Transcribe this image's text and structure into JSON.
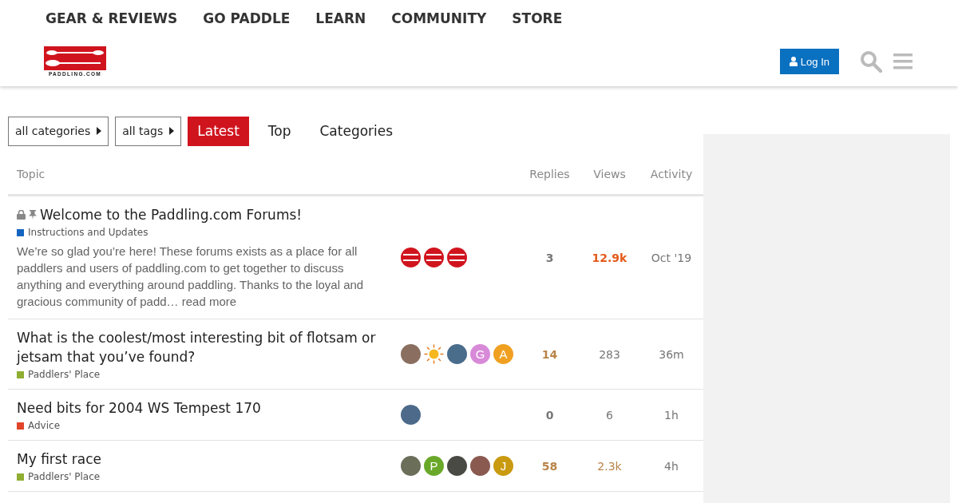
{
  "top_nav": [
    "GEAR & REVIEWS",
    "GO PADDLE",
    "LEARN",
    "COMMUNITY",
    "STORE"
  ],
  "logo": {
    "caption": "PADDLING.COM"
  },
  "header_actions": {
    "login": "Log In"
  },
  "filters": [
    {
      "label": "all categories"
    },
    {
      "label": "all tags"
    }
  ],
  "tabs": [
    {
      "label": "Latest",
      "selected": true
    },
    {
      "label": "Top",
      "selected": false
    },
    {
      "label": "Categories",
      "selected": false
    }
  ],
  "table": {
    "columns": [
      "Topic",
      "Replies",
      "Views",
      "Activity"
    ],
    "rows": [
      {
        "title": "Welcome to the Paddling.com Forums!",
        "locked": true,
        "pinned": true,
        "category": {
          "name": "Instructions and Updates",
          "color": "#1565c0"
        },
        "excerpt": "We’re so glad you’re here! These forums exists as a place for all paddlers and users of paddling.com to get together to discuss anything and everything around paddling. Thanks to the loyal and gracious community of padd…",
        "read_more": "read more",
        "posters": [
          {
            "kind": "logo"
          },
          {
            "kind": "logo"
          },
          {
            "kind": "logo"
          }
        ],
        "replies": {
          "text": "3",
          "color": "#777777"
        },
        "views": {
          "text": "12.9k",
          "color": "#e45a1a",
          "bold": true
        },
        "activity": "Oct '19"
      },
      {
        "title": "What is the coolest/most interesting bit of flotsam or jetsam that you’ve found?",
        "locked": false,
        "pinned": false,
        "category": {
          "name": "Paddlers' Place",
          "color": "#8fae32"
        },
        "posters": [
          {
            "kind": "photo",
            "color": "#8a6f60"
          },
          {
            "kind": "sun"
          },
          {
            "kind": "photo",
            "color": "#4a6d8c"
          },
          {
            "kind": "letter",
            "letter": "G",
            "color": "#d88ad8"
          },
          {
            "kind": "letter",
            "letter": "A",
            "color": "#f0a020"
          }
        ],
        "replies": {
          "text": "14",
          "color": "#b88448"
        },
        "views": {
          "text": "283",
          "color": "#777777",
          "bold": false
        },
        "activity": "36m"
      },
      {
        "title": "Need bits for 2004 WS Tempest 170",
        "locked": false,
        "pinned": false,
        "category": {
          "name": "Advice",
          "color": "#e0452a"
        },
        "posters": [
          {
            "kind": "photo",
            "color": "#4d6a8a"
          }
        ],
        "replies": {
          "text": "0",
          "color": "#777777"
        },
        "views": {
          "text": "6",
          "color": "#777777",
          "bold": false
        },
        "activity": "1h"
      },
      {
        "title": "My first race",
        "locked": false,
        "pinned": false,
        "category": {
          "name": "Paddlers' Place",
          "color": "#8fae32"
        },
        "posters": [
          {
            "kind": "photo",
            "color": "#6b6f5a"
          },
          {
            "kind": "letter",
            "letter": "P",
            "color": "#6aa82a"
          },
          {
            "kind": "photo",
            "color": "#4a4a44"
          },
          {
            "kind": "photo",
            "color": "#8a5a50"
          },
          {
            "kind": "letter",
            "letter": "J",
            "color": "#c99a10"
          }
        ],
        "replies": {
          "text": "58",
          "color": "#b88448"
        },
        "views": {
          "text": "2.3k",
          "color": "#b88448",
          "bold": false
        },
        "activity": "4h"
      }
    ]
  }
}
